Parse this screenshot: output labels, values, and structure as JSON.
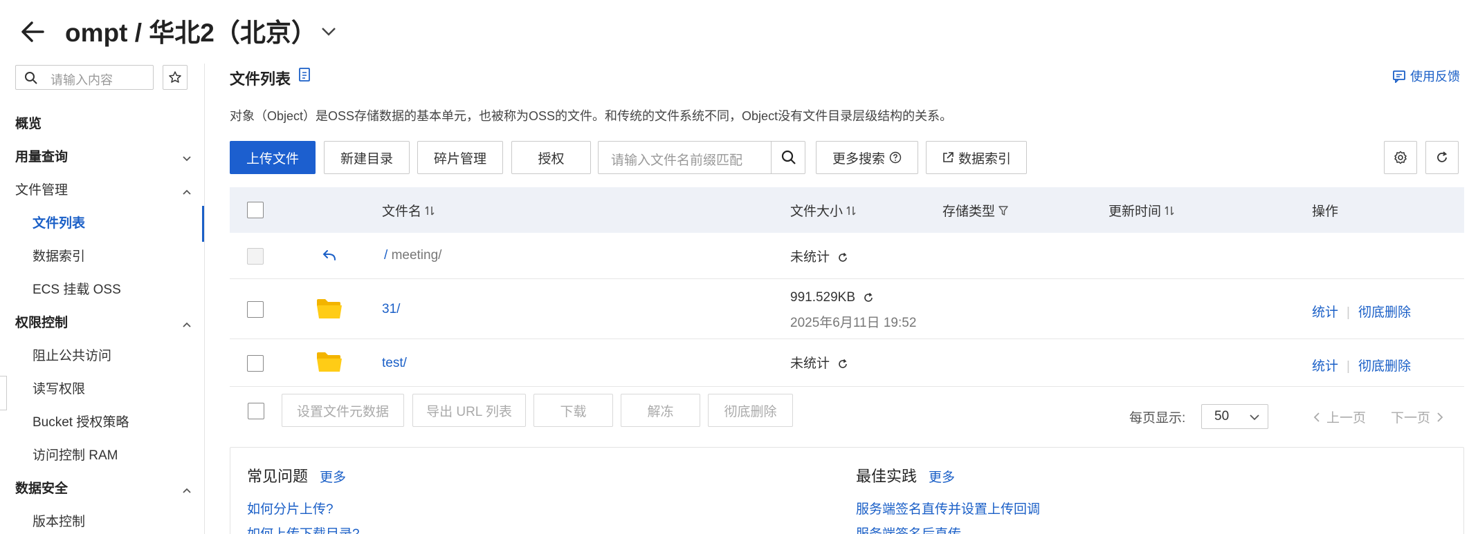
{
  "header": {
    "title": "ompt / 华北2（北京）"
  },
  "sidebar": {
    "search_placeholder": "请输入内容",
    "items": [
      {
        "label": "概览"
      },
      {
        "label": "用量查询"
      },
      {
        "label": "文件管理"
      },
      {
        "label": "文件列表"
      },
      {
        "label": "数据索引"
      },
      {
        "label": "ECS 挂载 OSS"
      },
      {
        "label": "权限控制"
      },
      {
        "label": "阻止公共访问"
      },
      {
        "label": "读写权限"
      },
      {
        "label": "Bucket 授权策略"
      },
      {
        "label": "访问控制 RAM"
      },
      {
        "label": "数据安全"
      },
      {
        "label": "版本控制"
      }
    ]
  },
  "main": {
    "title": "文件列表",
    "feedback": "使用反馈",
    "description": "对象（Object）是OSS存储数据的基本单元，也被称为OSS的文件。和传统的文件系统不同，Object没有文件目录层级结构的关系。",
    "toolbar": {
      "upload": "上传文件",
      "new_dir": "新建目录",
      "fragments": "碎片管理",
      "authorize": "授权",
      "search_placeholder": "请输入文件名前缀匹配",
      "more_search": "更多搜索",
      "data_index": "数据索引"
    },
    "table": {
      "columns": {
        "name": "文件名",
        "size": "文件大小",
        "storage": "存储类型",
        "updated": "更新时间",
        "actions": "操作"
      },
      "parent_row": {
        "path_prefix": "/",
        "path": "meeting/",
        "size": "未统计"
      },
      "rows": [
        {
          "name": "31/",
          "size": "991.529KB",
          "date": "2025年6月11日 19:52",
          "action1": "统计",
          "action2": "彻底删除"
        },
        {
          "name": "test/",
          "size": "未统计",
          "action1": "统计",
          "action2": "彻底删除"
        }
      ]
    },
    "footer": {
      "set_meta": "设置文件元数据",
      "export_url": "导出 URL 列表",
      "download": "下载",
      "unfreeze": "解冻",
      "delete": "彻底删除",
      "per_page_label": "每页显示:",
      "per_page_value": "50",
      "prev": "上一页",
      "next": "下一页"
    },
    "faq": {
      "title": "常见问题",
      "more": "更多",
      "links": [
        "如何分片上传?",
        "如何上传下载目录?"
      ]
    },
    "best": {
      "title": "最佳实践",
      "more": "更多",
      "links": [
        "服务端签名直传并设置上传回调",
        "服务端签名后直传"
      ]
    }
  }
}
